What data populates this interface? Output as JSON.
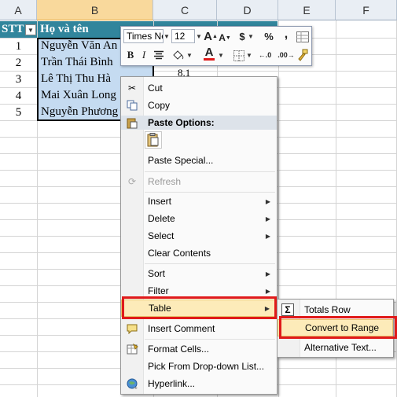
{
  "columns": [
    "A",
    "B",
    "C",
    "D",
    "E",
    "F"
  ],
  "table": {
    "headers": {
      "stt": "STT",
      "name": "Họ và tên"
    },
    "stt": [
      "1",
      "2",
      "3",
      "4",
      "5"
    ],
    "names": [
      "Nguyễn Văn An",
      "Trần Thái Bình",
      "Lê Thị Thu Hà",
      "Mai Xuân Long",
      "Nguyễn Phương"
    ],
    "c3_partial": "8.1"
  },
  "mini_toolbar": {
    "font_name": "Times Ne",
    "font_size": "12",
    "grow_font": "A",
    "shrink_font": "A",
    "currency": "$",
    "percent": "%",
    "comma": ",",
    "bold": "B",
    "italic": "I",
    "font_color_letter": "A",
    "increase_decimal": ".0→.00",
    "decrease_decimal": ".00→.0"
  },
  "context_menu": {
    "cut": "Cut",
    "copy": "Copy",
    "paste_options": "Paste Options:",
    "paste_special": "Paste Special...",
    "refresh": "Refresh",
    "insert": "Insert",
    "delete": "Delete",
    "select": "Select",
    "clear_contents": "Clear Contents",
    "sort": "Sort",
    "filter": "Filter",
    "table": "Table",
    "insert_comment": "Insert Comment",
    "format_cells": "Format Cells...",
    "pick_from_dropdown": "Pick From Drop-down List...",
    "hyperlink": "Hyperlink..."
  },
  "table_submenu": {
    "totals_row": "Totals Row",
    "convert_to_range": "Convert to Range",
    "alternative_text": "Alternative Text..."
  },
  "colors": {
    "header_fill": "#31859c",
    "selected_fill": "#c5dbf1",
    "highlight": "#fdebb9",
    "annotation_red": "#e01a1a"
  }
}
